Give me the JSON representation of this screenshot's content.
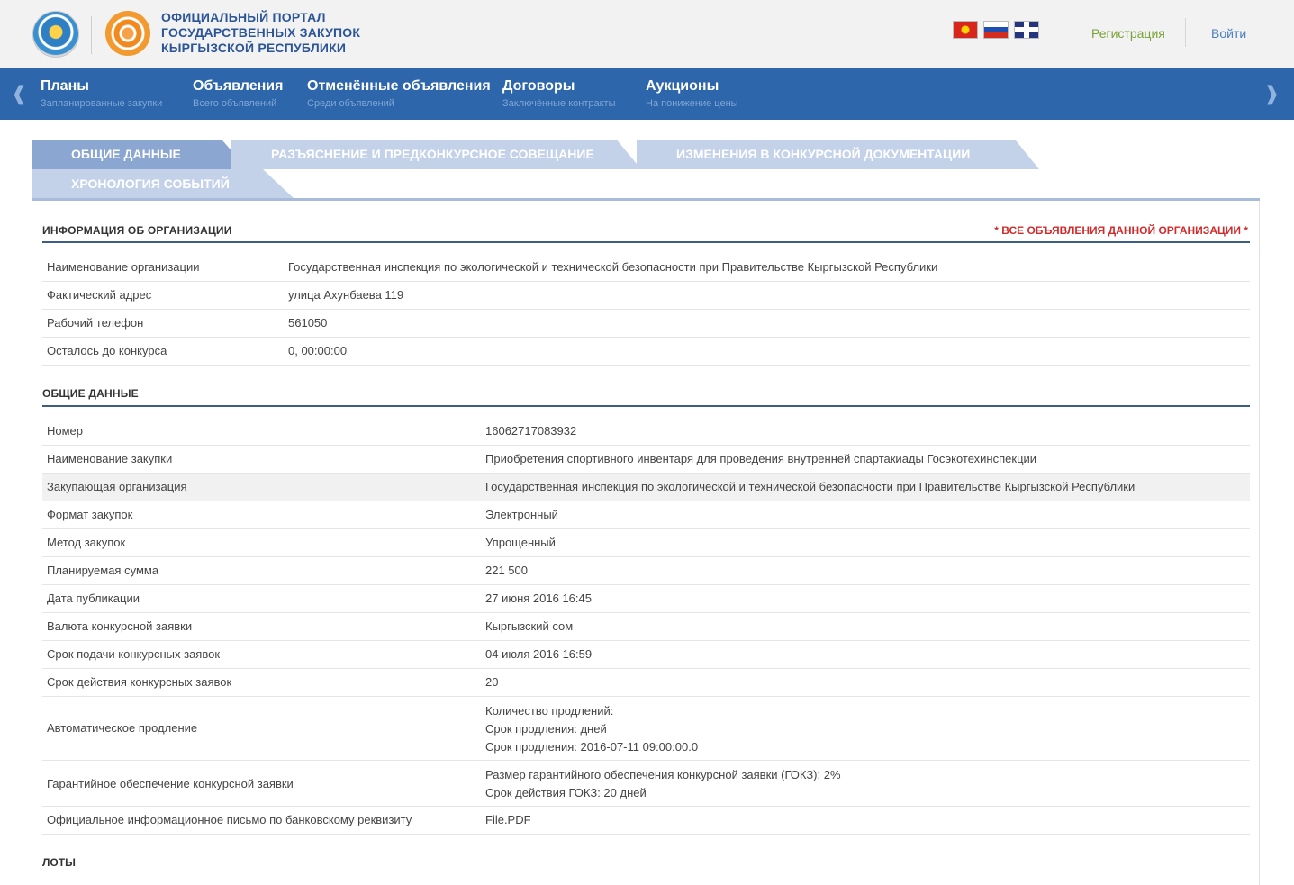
{
  "header": {
    "portal_title_line1": "ОФИЦИАЛЬНЫЙ ПОРТАЛ",
    "portal_title_line2": "ГОСУДАРСТВЕННЫХ ЗАКУПОК",
    "portal_title_line3": "КЫРГЫЗСКОЙ РЕСПУБЛИКИ",
    "register_label": "Регистрация",
    "login_label": "Войти",
    "flags": [
      "kyrgyzstan-flag-icon",
      "russia-flag-icon",
      "uk-flag-icon"
    ]
  },
  "nav": {
    "items": [
      {
        "title": "Планы",
        "subtitle": "Запланированные закупки"
      },
      {
        "title": "Объявления",
        "subtitle": "Всего объявлений"
      },
      {
        "title": "Отменённые объявления",
        "subtitle": "Среди объявлений"
      },
      {
        "title": "Договоры",
        "subtitle": "Заключённые контракты"
      },
      {
        "title": "Аукционы",
        "subtitle": "На понижение цены"
      }
    ],
    "prev_icon": "arrow-left-icon",
    "next_icon": "arrow-right-icon"
  },
  "tabs": [
    {
      "label": "ОБЩИЕ ДАННЫЕ",
      "active": true
    },
    {
      "label": "РАЗЪЯСНЕНИЕ И ПРЕДКОНКУРСНОЕ СОВЕЩАНИЕ",
      "active": false
    },
    {
      "label": "ИЗМЕНЕНИЯ В КОНКУРСНОЙ ДОКУМЕНТАЦИИ",
      "active": false
    },
    {
      "label": "ХРОНОЛОГИЯ СОБЫТИЙ",
      "active": false
    }
  ],
  "org_section": {
    "title": "ИНФОРМАЦИЯ ОБ ОРГАНИЗАЦИИ",
    "all_ads_link": "* ВСЕ ОБЪЯВЛЕНИЯ ДАННОЙ ОРГАНИЗАЦИИ *",
    "rows": [
      {
        "label": "Наименование организации",
        "value": "Государственная инспекция по экологической и технической безопасности при Правительстве Кыргызской Республики"
      },
      {
        "label": "Фактический адрес",
        "value": "улица Ахунбаева 119"
      },
      {
        "label": "Рабочий телефон",
        "value": "561050"
      },
      {
        "label": "Осталось до конкурса",
        "value": "0, 00:00:00"
      }
    ]
  },
  "general_section": {
    "title": "ОБЩИЕ ДАННЫЕ",
    "rows": [
      {
        "label": "Номер",
        "value": "16062717083932"
      },
      {
        "label": "Наименование закупки",
        "value": "Приобретения спортивного инвентаря для проведения внутренней спартакиады Госэкотехинспекции"
      },
      {
        "label": "Закупающая организация",
        "value": "Государственная инспекция по экологической и технической безопасности при Правительстве Кыргызской Республики"
      },
      {
        "label": "Формат закупок",
        "value": "Электронный"
      },
      {
        "label": "Метод закупок",
        "value": "Упрощенный"
      },
      {
        "label": "Планируемая сумма",
        "value": "221 500"
      },
      {
        "label": "Дата публикации",
        "value": "27 июня 2016 16:45"
      },
      {
        "label": "Валюта конкурсной заявки",
        "value": "Кыргызский сом"
      },
      {
        "label": "Срок подачи конкурсных заявок",
        "value": "04 июля 2016 16:59"
      },
      {
        "label": "Срок действия конкурсных заявок",
        "value": "20"
      },
      {
        "label": "Автоматическое продление",
        "lines": [
          "Количество продлений:",
          "Срок продления: дней",
          "Срок продления: 2016-07-11 09:00:00.0"
        ]
      },
      {
        "label": "Гарантийное обеспечение конкурсной заявки",
        "lines": [
          "Размер гарантийного обеспечения конкурсной заявки (ГОКЗ): 2%",
          "Срок действия ГОКЗ: 20 дней"
        ]
      },
      {
        "label": "Официальное информационное письмо по банковскому реквизиту",
        "value": "File.PDF"
      }
    ]
  },
  "lots_section": {
    "title": "ЛОТЫ"
  }
}
